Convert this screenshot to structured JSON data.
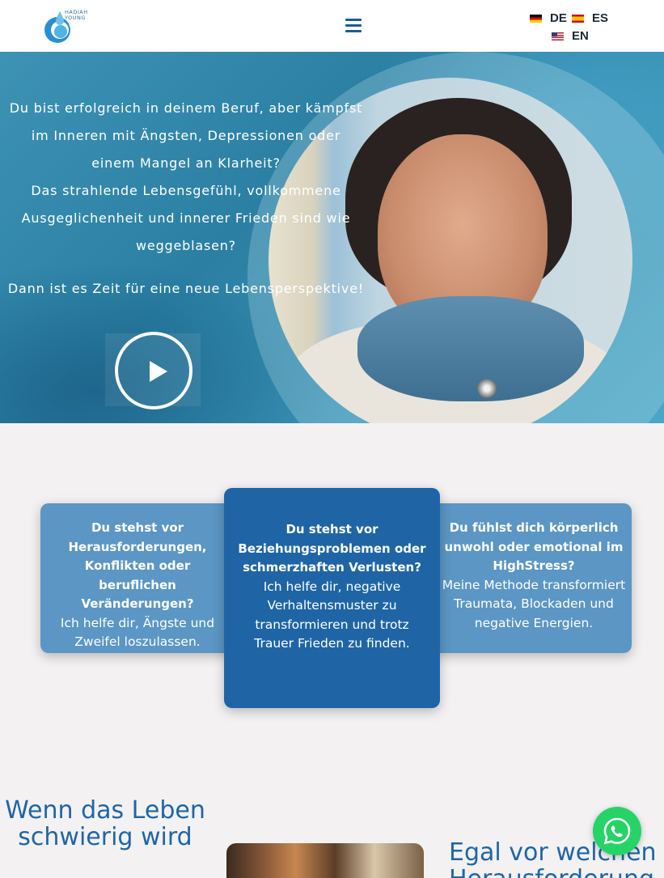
{
  "header": {
    "logo_text": "HADIAH YOUNG",
    "menu_icon": "hamburger-icon",
    "languages": [
      {
        "code": "DE",
        "flag": "flag-de-icon"
      },
      {
        "code": "ES",
        "flag": "flag-es-icon"
      },
      {
        "code": "EN",
        "flag": "flag-us-icon"
      }
    ]
  },
  "hero": {
    "intro_lines": [
      "Du bist erfolgreich in deinem Beruf, aber kämpfst",
      "im Inneren mit Ängsten, Depressionen oder",
      "einem Mangel an Klarheit?",
      "Das strahlende Lebensgefühl, vollkommene",
      "Ausgeglichenheit und innerer Frieden sind wie",
      "weggeblasen?"
    ],
    "cta_line": "Dann ist es Zeit für eine neue Lebensperspektive!",
    "play_icon": "play-icon"
  },
  "cards": [
    {
      "question": "Du stehst vor Herausforderungen, Konflikten oder beruflichen Veränderungen?",
      "answer": "Ich helfe dir, Ängste und Zweifel loszulassen."
    },
    {
      "question": "Du stehst vor Beziehungsproblemen oder schmerzhaften Verlusten?",
      "answer": "Ich helfe dir, negative Verhaltensmuster zu transformieren und trotz Trauer Frieden zu finden."
    },
    {
      "question": "Du fühlst dich körperlich unwohl oder emotional im HighStress?",
      "answer": "Meine Methode transformiert Traumata, Blockaden und negative Energien."
    }
  ],
  "section2": {
    "left_heading": "Wenn das Leben schwierig wird",
    "right_heading_line1": "Egal vor welchen",
    "right_heading_line2": "Herausforderung"
  },
  "colors": {
    "accent": "#1f65a6",
    "card_side": "#5b96c4",
    "whatsapp": "#25d366"
  }
}
